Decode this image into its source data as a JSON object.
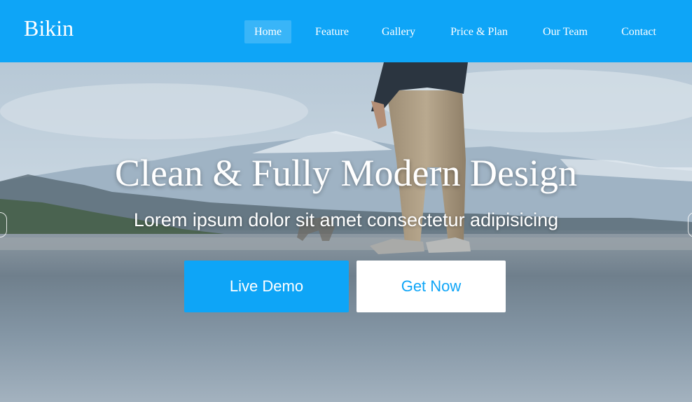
{
  "header": {
    "logo": "Bikin",
    "nav": [
      {
        "label": "Home",
        "active": true
      },
      {
        "label": "Feature",
        "active": false
      },
      {
        "label": "Gallery",
        "active": false
      },
      {
        "label": "Price & Plan",
        "active": false
      },
      {
        "label": "Our Team",
        "active": false
      },
      {
        "label": "Contact",
        "active": false
      }
    ]
  },
  "hero": {
    "title": "Clean & Fully Modern Design",
    "subtitle": "Lorem ipsum dolor sit amet consectetur adipisicing",
    "primary_button": "Live Demo",
    "secondary_button": "Get Now"
  },
  "colors": {
    "brand": "#0ea5f7",
    "white": "#ffffff"
  },
  "icons": {
    "slider_prev": "chevron-left-icon",
    "slider_next": "chevron-right-icon"
  }
}
